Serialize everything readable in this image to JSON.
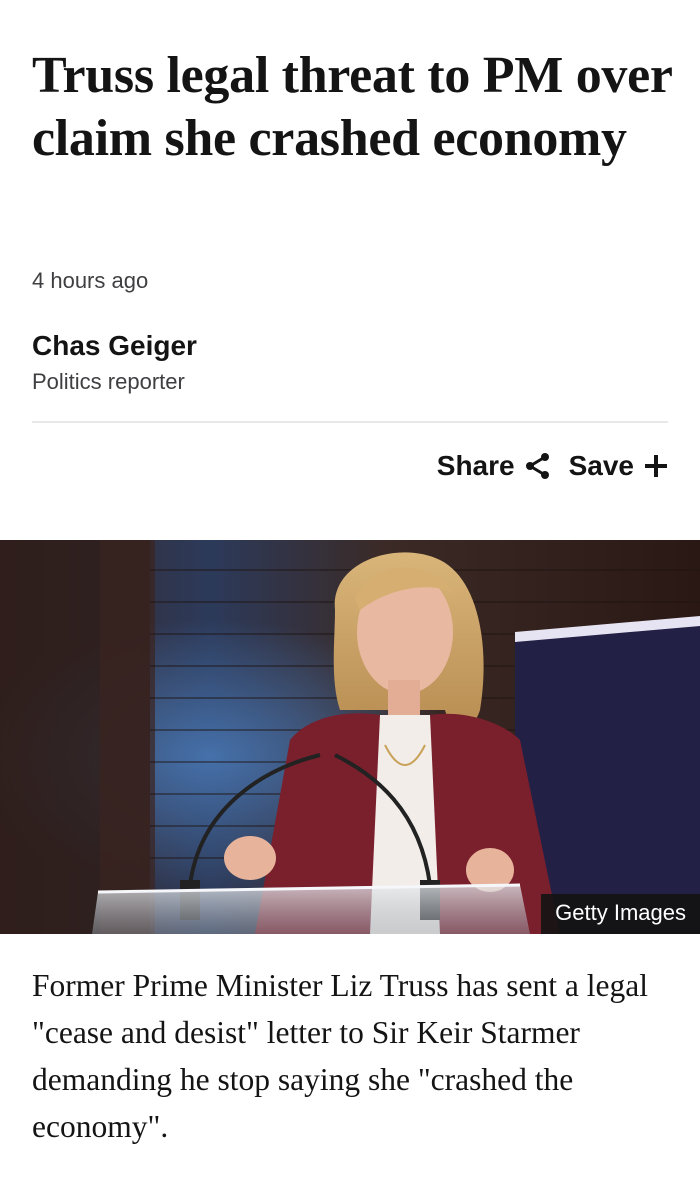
{
  "article": {
    "headline": "Truss legal threat to PM over claim she crashed economy",
    "timestamp": "4 hours ago",
    "author": {
      "name": "Chas Geiger",
      "role": "Politics reporter"
    },
    "actions": {
      "share_label": "Share",
      "save_label": "Save",
      "share_icon": "share-icon",
      "save_icon": "plus-icon"
    },
    "image": {
      "credit": "Getty Images"
    },
    "paragraphs": [
      "Former Prime Minister Liz Truss has sent a legal \"cease and desist\" letter to Sir Keir Starmer demanding he stop saying she \"crashed the economy\"."
    ]
  }
}
